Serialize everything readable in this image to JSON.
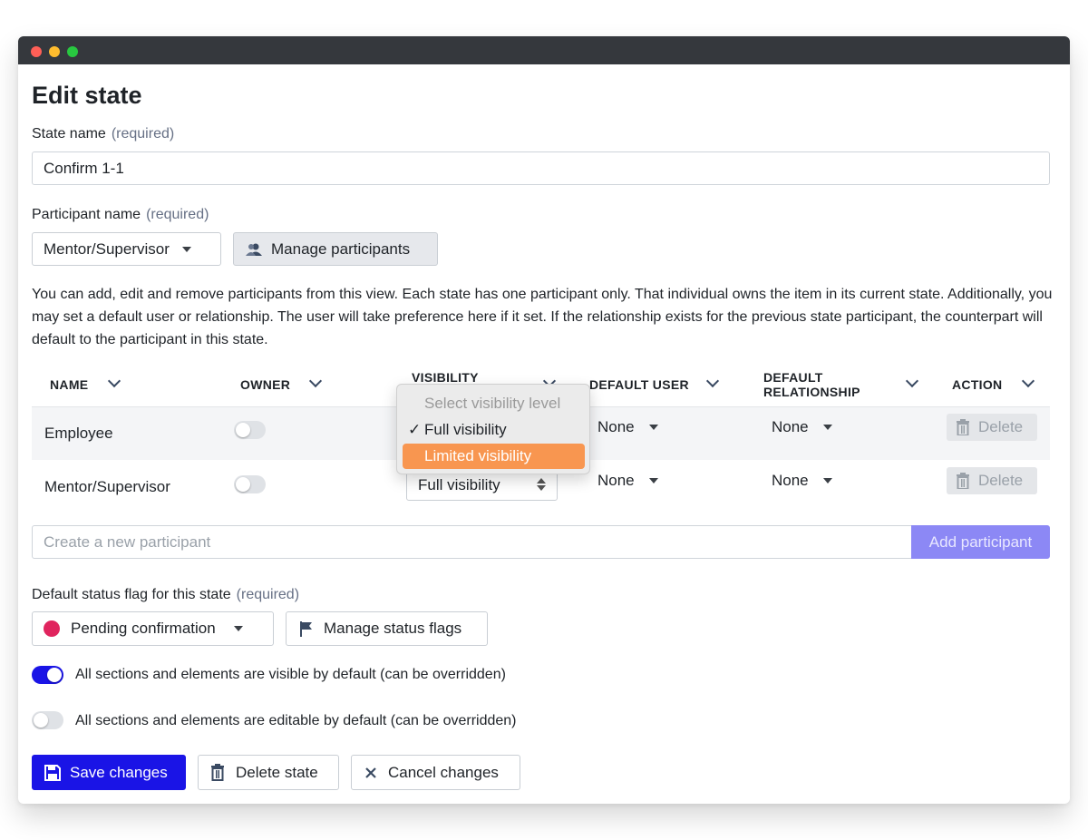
{
  "page": {
    "title": "Edit state",
    "required_text": "(required)"
  },
  "state_name": {
    "label": "State name",
    "value": "Confirm 1-1"
  },
  "participant": {
    "label": "Participant name",
    "selected": "Mentor/Supervisor",
    "manage_label": "Manage participants"
  },
  "description": "You can add, edit and remove participants from this view. Each state has one participant only. That individual owns the item in its current state. Additionally, you may set a default user or relationship. The user will take preference here if it set. If the relationship exists for the previous state participant, the counterpart will default to the participant in this state.",
  "table": {
    "headers": {
      "name": "NAME",
      "owner": "OWNER",
      "visibility": "VISIBILITY",
      "default_user": "DEFAULT USER",
      "default_relationship_1": "DEFAULT",
      "default_relationship_2": "RELATIONSHIP",
      "action": "ACTION"
    },
    "rows": [
      {
        "name": "Employee",
        "owner": false,
        "visibility": "Full visibility",
        "default_user": "None",
        "default_relationship": "None",
        "action": "Delete"
      },
      {
        "name": "Mentor/Supervisor",
        "owner": false,
        "visibility": "Full visibility",
        "default_user": "None",
        "default_relationship": "None",
        "action": "Delete"
      }
    ]
  },
  "visibility_dropdown": {
    "placeholder": "Select visibility level",
    "options": [
      "Full visibility",
      "Limited visibility"
    ],
    "checked": "Full visibility",
    "highlighted": "Limited visibility",
    "check_glyph": "✓"
  },
  "new_participant": {
    "placeholder": "Create a new participant",
    "add_label": "Add participant"
  },
  "status_flag": {
    "label": "Default status flag for this state",
    "selected": "Pending confirmation",
    "selected_color": "#e0245e",
    "manage_label": "Manage status flags"
  },
  "toggles": {
    "visible_label": "All sections and elements are visible by default (can be overridden)",
    "visible_on": true,
    "editable_label": "All sections and elements are editable by default (can be overridden)",
    "editable_on": false
  },
  "actions": {
    "save": "Save changes",
    "delete": "Delete state",
    "cancel": "Cancel changes"
  },
  "colors": {
    "primary": "#1a14e6",
    "add_participant_bg": "#8c88f5",
    "highlight": "#f89650"
  }
}
